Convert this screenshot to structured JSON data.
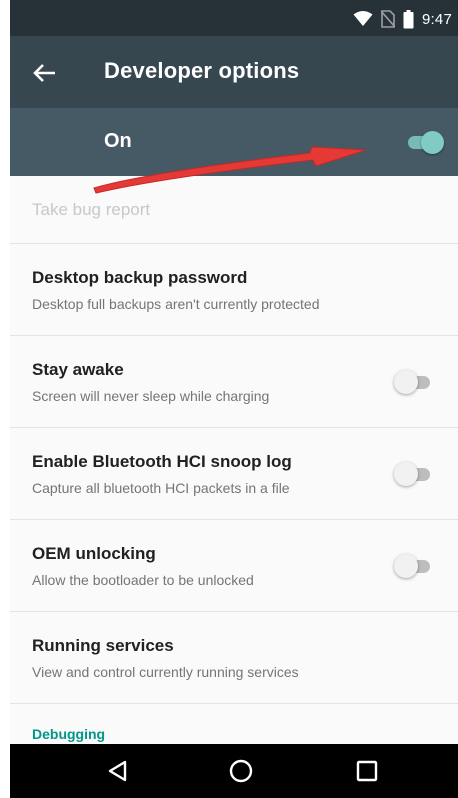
{
  "status_bar": {
    "time": "9:47",
    "icons": [
      "wifi-icon",
      "no-sim-icon",
      "battery-icon"
    ]
  },
  "toolbar": {
    "back_icon": "back-arrow-icon",
    "title": "Developer options"
  },
  "master_switch": {
    "label": "On",
    "state": true,
    "accent_color": "#80cbc4"
  },
  "annotation": {
    "type": "red-arrow",
    "color": "#e53935"
  },
  "items": [
    {
      "title": "Take bug report",
      "summary": "",
      "enabled": false
    },
    {
      "title": "Desktop backup password",
      "summary": "Desktop full backups aren't currently protected"
    },
    {
      "title": "Stay awake",
      "summary": "Screen will never sleep while charging",
      "toggle": false
    },
    {
      "title": "Enable Bluetooth HCI snoop log",
      "summary": "Capture all bluetooth HCI packets in a file",
      "toggle": false
    },
    {
      "title": "OEM unlocking",
      "summary": "Allow the bootloader to be unlocked",
      "toggle": false
    },
    {
      "title": "Running services",
      "summary": "View and control currently running services"
    }
  ],
  "section_header": "Debugging",
  "nav_bar": {
    "buttons": [
      "back-triangle-icon",
      "home-circle-icon",
      "recents-square-icon"
    ]
  },
  "colors": {
    "status_bar": "#263238",
    "toolbar": "#37474f",
    "on_bar": "#455a64",
    "section_accent": "#009688"
  }
}
